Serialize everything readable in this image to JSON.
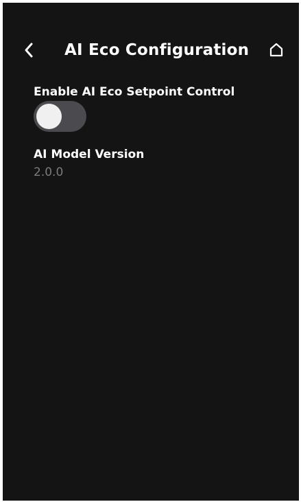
{
  "header": {
    "title": "AI Eco Configuration",
    "back_icon": "chevron-left-icon",
    "home_icon": "home-icon"
  },
  "settings": {
    "eco_setpoint": {
      "label": "Enable AI Eco Setpoint Control",
      "enabled": false
    },
    "model_version": {
      "label": "AI Model Version",
      "value": "2.0.0"
    }
  },
  "colors": {
    "background": "#141414",
    "text": "#ffffff",
    "muted_text": "#7c7c7c",
    "toggle_track_off": "#4a4a4f",
    "toggle_knob": "#f0f0f0"
  }
}
